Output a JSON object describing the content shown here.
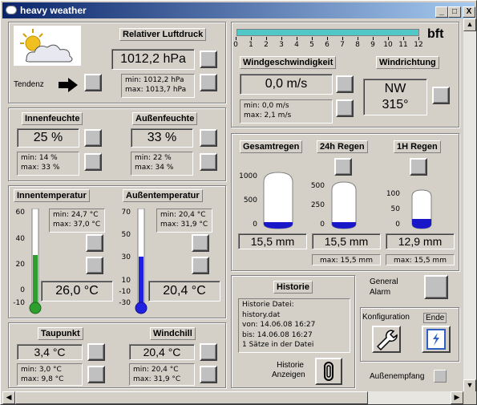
{
  "window": {
    "title": "heavy weather",
    "btn_min": "_",
    "btn_max": "□",
    "btn_close": "X"
  },
  "pressure": {
    "label": "Relativer Luftdruck",
    "value": "1012,2 hPa",
    "min": "min: 1012,2 hPa",
    "max": "max: 1013,7 hPa",
    "trend_label": "Tendenz"
  },
  "wind_scale": {
    "unit": "bft",
    "ticks": [
      "0",
      "1",
      "2",
      "3",
      "4",
      "5",
      "6",
      "7",
      "8",
      "9",
      "10",
      "11",
      "12"
    ],
    "level": 1.0
  },
  "wind": {
    "speed_label": "Windgeschwindigkeit",
    "speed": "0,0 m/s",
    "min": "min: 0,0 m/s",
    "max": "max: 2,1 m/s",
    "dir_label": "Windrichtung",
    "dir": "NW",
    "deg": "315°"
  },
  "humidity": {
    "in_label": "Innenfeuchte",
    "in_value": "25 %",
    "in_min": "min: 14 %",
    "in_max": "max: 33 %",
    "out_label": "Außenfeuchte",
    "out_value": "33 %",
    "out_min": "min: 22 %",
    "out_max": "max: 34 %"
  },
  "rain": {
    "total_label": "Gesamtregen",
    "h24_label": "24h Regen",
    "h1_label": "1H Regen",
    "total": "15,5 mm",
    "h24": "15,5 mm",
    "h1": "12,9 mm",
    "h24_max": "max: 15,5 mm",
    "h1_max": "max: 15,5 mm",
    "total_ticks": [
      "1000",
      "500",
      "0"
    ],
    "h24_ticks": [
      "500",
      "250",
      "0"
    ],
    "h1_ticks": [
      "100",
      "50",
      "0"
    ]
  },
  "temperature": {
    "in_label": "Innentemperatur",
    "out_label": "Außentemperatur",
    "in_value": "26,0 °C",
    "out_value": "20,4 °C",
    "in_min": "min: 24,7 °C",
    "in_max": "max: 37,0 °C",
    "out_min": "min: 20,4 °C",
    "out_max": "max: 31,9 °C",
    "in_ticks": [
      "60",
      "40",
      "20",
      "0",
      "-10"
    ],
    "out_ticks": [
      "70",
      "50",
      "30",
      "10",
      "-10",
      "-30"
    ]
  },
  "dewpoint": {
    "label": "Taupunkt",
    "value": "3,4 °C",
    "min": "min: 3,0 °C",
    "max": "max: 9,8 °C"
  },
  "windchill": {
    "label": "Windchill",
    "value": "20,4 °C",
    "min": "min: 20,4 °C",
    "max": "max: 31,9 °C"
  },
  "history": {
    "label": "Historie",
    "line1": "Historie Datei:",
    "line2": "history.dat",
    "line3": "von:  14.06.08 16:27",
    "line4": "bis:  14.06.08 16:27",
    "line5": "1 Sätze in der Datei",
    "show1": "Historie",
    "show2": "Anzeigen"
  },
  "alarm": {
    "line1": "General",
    "line2": "Alarm"
  },
  "config": {
    "label": "Konfiguration",
    "end": "Ende"
  },
  "reception": {
    "label": "Außenempfang"
  },
  "colors": {
    "title_start": "#0a246a",
    "title_end": "#a6caf0",
    "wind_bar": "#50c8c8",
    "in_temp_fill": "#2e9e2e",
    "out_temp_fill": "#2020e0",
    "rain_fill": "#1818c8"
  }
}
